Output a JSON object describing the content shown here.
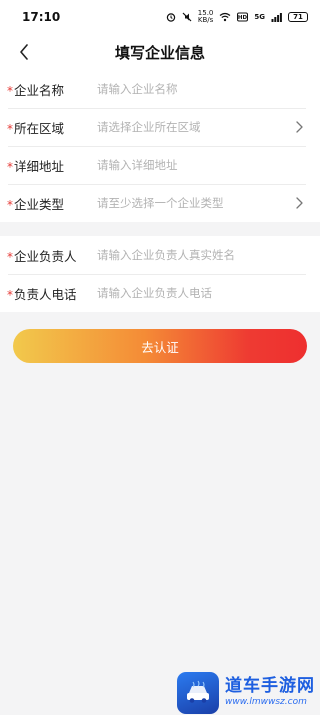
{
  "status_bar": {
    "time": "17:10",
    "net_speed_value": "15.0",
    "net_speed_unit": "KB/s",
    "signal_label": "5G",
    "battery_level": "71"
  },
  "header": {
    "title": "填写企业信息"
  },
  "form_section_1": [
    {
      "label": "企业名称",
      "required": true,
      "placeholder": "请输入企业名称",
      "has_chevron": false
    },
    {
      "label": "所在区域",
      "required": true,
      "placeholder": "请选择企业所在区域",
      "has_chevron": true
    },
    {
      "label": "详细地址",
      "required": true,
      "placeholder": "请输入详细地址",
      "has_chevron": false
    },
    {
      "label": "企业类型",
      "required": true,
      "placeholder": "请至少选择一个企业类型",
      "has_chevron": true
    }
  ],
  "form_section_2": [
    {
      "label": "企业负责人",
      "required": true,
      "placeholder": "请输入企业负责人真实姓名",
      "has_chevron": false
    },
    {
      "label": "负责人电话",
      "required": true,
      "placeholder": "请输入企业负责人电话",
      "has_chevron": false
    }
  ],
  "submit_button": {
    "label": "去认证"
  },
  "watermark": {
    "name": "道车手游网",
    "url": "www.lmwwsz.com"
  },
  "colors": {
    "required_mark": "#e53935",
    "button_gradient_start": "#f2c94c",
    "button_gradient_end": "#ee2f2f",
    "watermark_blue": "#1e5fe0"
  }
}
